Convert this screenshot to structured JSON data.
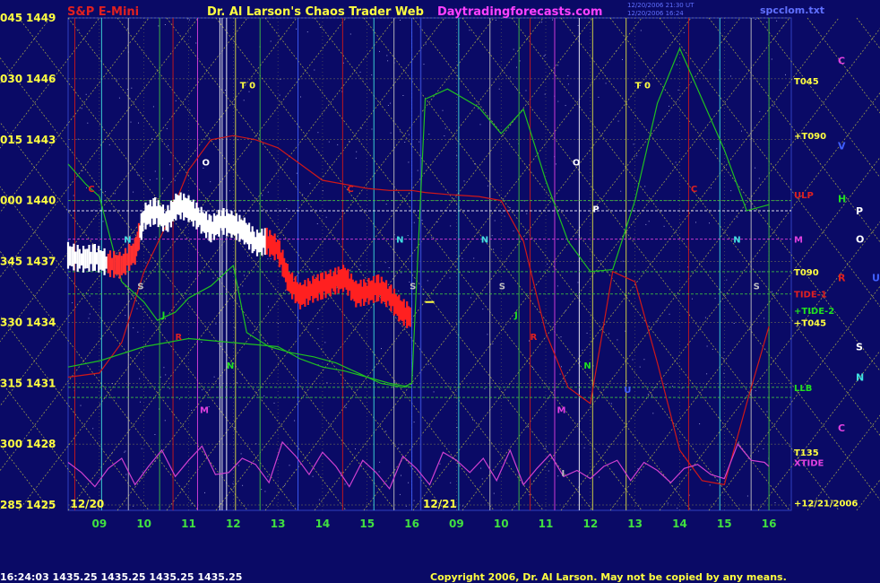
{
  "header": {
    "instrument": "S&P E-Mini",
    "site": "Dr. Al Larson's Chaos Trader Web",
    "url": "Daytradingforecasts.com",
    "stamp1": "12/20/2006 21:30 UT",
    "stamp2": "12/20/2006 16:24",
    "file": "spcclom.txt"
  },
  "footer": {
    "quote": "16:24:03  1435.25 1435.25 1435.25 1435.25",
    "copyright": "Copyright 2006, Dr. Al Larson. May not be copied by any means."
  },
  "colors": {
    "background": "#0a0a66",
    "grid_yellow": "#e0e040",
    "grid_green": "#40d040",
    "cyan": "#40e0e0",
    "magenta": "#e040e0",
    "red": "#e02020",
    "green": "#20e020",
    "white": "#ffffff"
  },
  "chart_data": {
    "type": "line",
    "title": "S&P E-Mini",
    "ylim": [
      1425,
      1449
    ],
    "y_ticks": [
      {
        "code": "045",
        "value": 1449
      },
      {
        "code": "030",
        "value": 1446
      },
      {
        "code": "015",
        "value": 1443
      },
      {
        "code": "000",
        "value": 1440
      },
      {
        "code": "345",
        "value": 1437
      },
      {
        "code": "330",
        "value": 1434
      },
      {
        "code": "315",
        "value": 1431
      },
      {
        "code": "300",
        "value": 1428
      },
      {
        "code": "285",
        "value": 1425
      }
    ],
    "xlim": [
      8.3,
      24.5
    ],
    "x_ticks": [
      {
        "label": "09",
        "x": 9
      },
      {
        "label": "10",
        "x": 10
      },
      {
        "label": "11",
        "x": 11
      },
      {
        "label": "12",
        "x": 12
      },
      {
        "label": "13",
        "x": 13
      },
      {
        "label": "14",
        "x": 14
      },
      {
        "label": "15",
        "x": 15
      },
      {
        "label": "16",
        "x": 16
      },
      {
        "label": "09",
        "x": 17
      },
      {
        "label": "10",
        "x": 18
      },
      {
        "label": "11",
        "x": 19
      },
      {
        "label": "12",
        "x": 20
      },
      {
        "label": "13",
        "x": 21
      },
      {
        "label": "14",
        "x": 22
      },
      {
        "label": "15",
        "x": 23
      },
      {
        "label": "16",
        "x": 24
      }
    ],
    "day_labels": [
      {
        "text": "12/20",
        "x": 8.35
      },
      {
        "text": "12/21",
        "x": 16.25
      }
    ],
    "right_labels": [
      {
        "text": "T045",
        "value": 1445.9,
        "color": "#ffff40"
      },
      {
        "text": "+T090",
        "value": 1443.2,
        "color": "#ffff40"
      },
      {
        "text": "ULP",
        "value": 1440.3,
        "color": "#e02020"
      },
      {
        "text": "M",
        "value": 1438.1,
        "color": "#e040e0"
      },
      {
        "text": "T090",
        "value": 1436.5,
        "color": "#ffff40"
      },
      {
        "text": "TIDE-1",
        "value": 1435.4,
        "color": "#e02020"
      },
      {
        "text": "+TIDE-2",
        "value": 1434.6,
        "color": "#20e020"
      },
      {
        "text": "+T045",
        "value": 1434.0,
        "color": "#ffff40"
      },
      {
        "text": "LLB",
        "value": 1430.8,
        "color": "#20e020"
      },
      {
        "text": "T135",
        "value": 1427.6,
        "color": "#ffff40"
      },
      {
        "text": "XTIDE",
        "value": 1427.1,
        "color": "#e040e0"
      },
      {
        "text": "+12/21/2006",
        "value": 1425.1,
        "color": "#ffff40"
      }
    ],
    "planet_column": [
      {
        "text": "C",
        "value": 1446.9,
        "color": "#e040e0",
        "col": 0
      },
      {
        "text": "V",
        "value": 1442.7,
        "color": "#4060ff",
        "col": 0
      },
      {
        "text": "H",
        "value": 1440.1,
        "color": "#20e020",
        "col": 0
      },
      {
        "text": "P",
        "value": 1439.5,
        "color": "#ffffff",
        "col": 1
      },
      {
        "text": "O",
        "value": 1438.1,
        "color": "#ffffff",
        "col": 1
      },
      {
        "text": "R",
        "value": 1436.2,
        "color": "#e02020",
        "col": 0
      },
      {
        "text": "U",
        "value": 1436.2,
        "color": "#4060ff",
        "col": 2
      },
      {
        "text": "S",
        "value": 1432.8,
        "color": "#ffffff",
        "col": 1
      },
      {
        "text": "N",
        "value": 1431.3,
        "color": "#40e0e0",
        "col": 1
      },
      {
        "text": "C",
        "value": 1428.8,
        "color": "#e040e0",
        "col": 0
      }
    ],
    "markers": [
      {
        "text": "T 0",
        "x": 12.15,
        "value": 1445.7,
        "color": "#ffff40"
      },
      {
        "text": "T 0",
        "x": 21.0,
        "value": 1445.7,
        "color": "#ffff40"
      },
      {
        "text": "O",
        "x": 11.3,
        "value": 1441.9,
        "color": "#ffffff"
      },
      {
        "text": "O",
        "x": 19.6,
        "value": 1441.9,
        "color": "#ffffff"
      },
      {
        "text": "P",
        "x": 20.05,
        "value": 1439.6,
        "color": "#ffffff"
      },
      {
        "text": "C",
        "x": 8.75,
        "value": 1440.6,
        "color": "#e02020"
      },
      {
        "text": "C",
        "x": 14.55,
        "value": 1440.6,
        "color": "#e02020"
      },
      {
        "text": "C",
        "x": 22.25,
        "value": 1440.6,
        "color": "#e02020"
      },
      {
        "text": "N",
        "x": 9.55,
        "value": 1438.1,
        "color": "#40e0e0"
      },
      {
        "text": "N",
        "x": 15.65,
        "value": 1438.1,
        "color": "#40e0e0"
      },
      {
        "text": "N",
        "x": 17.55,
        "value": 1438.1,
        "color": "#40e0e0"
      },
      {
        "text": "N",
        "x": 23.2,
        "value": 1438.1,
        "color": "#40e0e0"
      },
      {
        "text": "S",
        "x": 9.85,
        "value": 1435.8,
        "color": "#c0c0c0"
      },
      {
        "text": "S",
        "x": 15.95,
        "value": 1435.8,
        "color": "#c0c0c0"
      },
      {
        "text": "S",
        "x": 17.95,
        "value": 1435.8,
        "color": "#c0c0c0"
      },
      {
        "text": "S",
        "x": 23.65,
        "value": 1435.8,
        "color": "#c0c0c0"
      },
      {
        "text": "J",
        "x": 10.4,
        "value": 1434.4,
        "color": "#20e020"
      },
      {
        "text": "J",
        "x": 18.3,
        "value": 1434.4,
        "color": "#20e020"
      },
      {
        "text": "R",
        "x": 10.7,
        "value": 1433.3,
        "color": "#e02020"
      },
      {
        "text": "R",
        "x": 18.65,
        "value": 1433.3,
        "color": "#e02020"
      },
      {
        "text": "N",
        "x": 11.85,
        "value": 1431.9,
        "color": "#20e020"
      },
      {
        "text": "N",
        "x": 19.85,
        "value": 1431.9,
        "color": "#20e020"
      },
      {
        "text": "M",
        "x": 11.25,
        "value": 1429.7,
        "color": "#e040e0"
      },
      {
        "text": "M",
        "x": 19.25,
        "value": 1429.7,
        "color": "#e040e0"
      },
      {
        "text": "U",
        "x": 20.75,
        "value": 1430.7,
        "color": "#4060ff"
      },
      {
        "text": "I",
        "x": 19.35,
        "value": 1426.6,
        "color": "#c0c0c0"
      }
    ],
    "series": [
      {
        "name": "S&P E-Mini",
        "kind": "price",
        "x": [
          8.3,
          8.6,
          8.9,
          9.2,
          9.5,
          9.8,
          10.0,
          10.25,
          10.5,
          10.75,
          11.0,
          11.25,
          11.5,
          11.75,
          12.0,
          12.25,
          12.5,
          12.75,
          13.0,
          13.25,
          13.5,
          13.75,
          14.0,
          14.25,
          14.5,
          14.75,
          15.0,
          15.25,
          15.5,
          15.75,
          16.0
        ],
        "values": [
          1437.3,
          1437.1,
          1437.2,
          1436.9,
          1436.8,
          1437.5,
          1439.2,
          1439.5,
          1439.0,
          1439.8,
          1439.6,
          1439.1,
          1438.6,
          1439.0,
          1438.8,
          1438.5,
          1437.9,
          1438.0,
          1437.6,
          1436.0,
          1435.3,
          1435.6,
          1435.8,
          1436.0,
          1436.2,
          1435.4,
          1435.5,
          1435.7,
          1435.3,
          1434.6,
          1434.2
        ]
      },
      {
        "name": "TIDE-1",
        "kind": "forecast",
        "color": "#d01818",
        "x": [
          8.3,
          9.0,
          9.5,
          10.0,
          10.5,
          11.0,
          11.5,
          12.0,
          12.5,
          13.0,
          13.5,
          14.0,
          14.5,
          15.0,
          15.5,
          16.0,
          16.3,
          16.8,
          17.5,
          18.0,
          18.5,
          19.0,
          19.5,
          20.0,
          20.5,
          21.0,
          21.5,
          22.0,
          22.5,
          23.0,
          23.5,
          24.0
        ],
        "values": [
          1431.3,
          1431.5,
          1433.0,
          1436.5,
          1438.8,
          1441.5,
          1443.0,
          1443.2,
          1443.0,
          1442.6,
          1441.8,
          1441.0,
          1440.8,
          1440.6,
          1440.5,
          1440.5,
          1440.4,
          1440.3,
          1440.2,
          1440.0,
          1438.0,
          1433.5,
          1430.8,
          1430.0,
          1436.5,
          1436.0,
          1432.0,
          1427.7,
          1426.2,
          1426.0,
          1430.0,
          1433.8
        ]
      },
      {
        "name": "TIDE-2",
        "kind": "forecast",
        "color": "#20c020",
        "x": [
          8.3,
          8.7,
          9.0,
          9.5,
          10.0,
          10.3,
          10.7,
          11.0,
          11.5,
          12.0,
          12.3,
          12.8,
          13.3,
          13.8,
          14.3,
          14.8,
          15.3,
          15.8,
          16.0,
          16.3,
          16.8,
          17.5,
          18.0,
          18.5,
          19.0,
          19.5,
          20.0,
          20.5,
          21.0,
          21.5,
          22.0,
          22.5,
          23.0,
          23.5,
          24.0
        ],
        "values": [
          1441.8,
          1440.8,
          1440.2,
          1436.0,
          1435.0,
          1434.1,
          1434.5,
          1435.2,
          1435.8,
          1436.8,
          1433.5,
          1432.8,
          1432.5,
          1432.3,
          1432.0,
          1431.5,
          1431.0,
          1430.8,
          1431.0,
          1445.0,
          1445.5,
          1444.6,
          1443.3,
          1444.5,
          1441.0,
          1438.0,
          1436.5,
          1436.6,
          1440.0,
          1444.8,
          1447.5,
          1445.0,
          1442.5,
          1439.5,
          1439.8
        ]
      },
      {
        "name": "LLB",
        "kind": "forecast",
        "color": "#20c020",
        "x": [
          8.3,
          9.0,
          10.0,
          10.5,
          11.0,
          12.0,
          13.0,
          13.5,
          14.0,
          14.5,
          15.0,
          15.5,
          16.0
        ],
        "values": [
          1431.8,
          1432.1,
          1432.8,
          1433.0,
          1433.2,
          1433.0,
          1432.8,
          1432.2,
          1431.8,
          1431.6,
          1431.3,
          1431.0,
          1430.8
        ]
      },
      {
        "name": "XTIDE",
        "kind": "forecast",
        "color": "#d040d0",
        "x": [
          8.3,
          8.6,
          8.9,
          9.2,
          9.5,
          9.8,
          10.1,
          10.4,
          10.7,
          11.0,
          11.3,
          11.6,
          11.9,
          12.2,
          12.5,
          12.8,
          13.1,
          13.4,
          13.7,
          14.0,
          14.3,
          14.6,
          14.9,
          15.2,
          15.5,
          15.8,
          16.1,
          16.4,
          16.7,
          17.0,
          17.3,
          17.6,
          17.9,
          18.2,
          18.5,
          18.8,
          19.1,
          19.4,
          19.7,
          20.0,
          20.3,
          20.6,
          20.9,
          21.2,
          21.5,
          21.8,
          22.1,
          22.4,
          22.7,
          23.0,
          23.3,
          23.6,
          23.9,
          24.0
        ],
        "values": [
          1427.1,
          1426.6,
          1425.9,
          1426.8,
          1427.3,
          1426.0,
          1426.9,
          1427.7,
          1426.4,
          1427.2,
          1427.9,
          1426.5,
          1426.6,
          1427.3,
          1427.0,
          1426.1,
          1428.1,
          1427.4,
          1426.5,
          1427.6,
          1426.9,
          1425.9,
          1427.2,
          1426.6,
          1425.8,
          1427.4,
          1426.8,
          1426.0,
          1427.6,
          1427.2,
          1426.6,
          1427.3,
          1426.2,
          1427.7,
          1426.0,
          1426.8,
          1427.5,
          1426.4,
          1426.7,
          1426.3,
          1426.9,
          1427.2,
          1426.2,
          1427.1,
          1426.7,
          1426.1,
          1426.8,
          1427.0,
          1426.5,
          1426.3,
          1428.0,
          1427.2,
          1427.1,
          1426.9
        ]
      }
    ],
    "vertical_lines": [
      {
        "x": 8.45,
        "color": "#d01818"
      },
      {
        "x": 9.05,
        "color": "#40e0e0"
      },
      {
        "x": 9.65,
        "color": "#c0c0c0"
      },
      {
        "x": 10.35,
        "color": "#40c040"
      },
      {
        "x": 10.65,
        "color": "#d01818"
      },
      {
        "x": 11.2,
        "color": "#e040e0"
      },
      {
        "x": 11.7,
        "color": "#ffffff"
      },
      {
        "x": 11.75,
        "color": "#ffffff"
      },
      {
        "x": 11.85,
        "color": "#ffffff"
      },
      {
        "x": 12.05,
        "color": "#e0e040"
      },
      {
        "x": 12.6,
        "color": "#40c040"
      },
      {
        "x": 13.45,
        "color": "#4060ff"
      },
      {
        "x": 14.45,
        "color": "#d01818"
      },
      {
        "x": 15.15,
        "color": "#40e0e0"
      },
      {
        "x": 15.6,
        "color": "#c0c0c0"
      },
      {
        "x": 16.0,
        "color": "#4060ff"
      },
      {
        "x": 17.05,
        "color": "#40e0e0"
      },
      {
        "x": 17.75,
        "color": "#c0c0c0"
      },
      {
        "x": 18.4,
        "color": "#40c040"
      },
      {
        "x": 18.65,
        "color": "#d01818"
      },
      {
        "x": 19.2,
        "color": "#e040e0"
      },
      {
        "x": 19.75,
        "color": "#ffffff"
      },
      {
        "x": 20.05,
        "color": "#e0e040"
      },
      {
        "x": 20.8,
        "color": "#e0e040"
      },
      {
        "x": 22.2,
        "color": "#d01818"
      },
      {
        "x": 22.9,
        "color": "#40e0e0"
      },
      {
        "x": 23.6,
        "color": "#c0c0c0"
      },
      {
        "x": 24.0,
        "color": "#40c040"
      }
    ],
    "horizontal_lines": [
      {
        "value": 1440.0,
        "color": "#40c040"
      },
      {
        "value": 1439.5,
        "color": "#ffffff"
      },
      {
        "value": 1438.1,
        "color": "#e040e0"
      },
      {
        "value": 1436.5,
        "color": "#40c040"
      },
      {
        "value": 1435.4,
        "color": "#40c040"
      },
      {
        "value": 1430.8,
        "color": "#40c040"
      },
      {
        "value": 1430.3,
        "color": "#40c040"
      }
    ],
    "grid": true
  }
}
